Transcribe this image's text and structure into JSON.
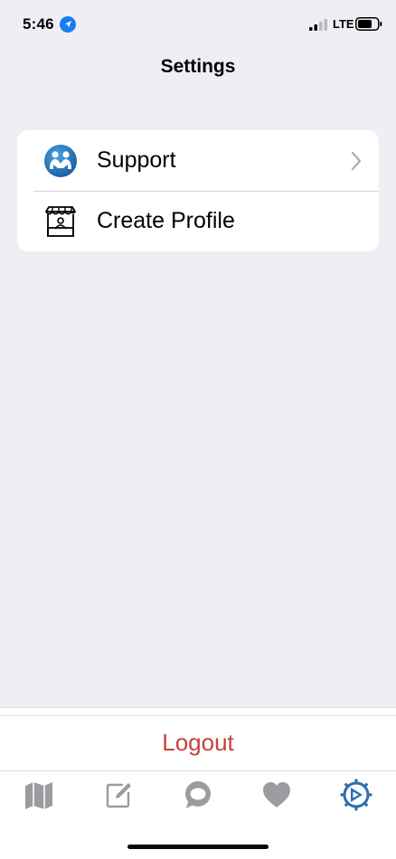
{
  "status_bar": {
    "time": "5:46",
    "network": "LTE"
  },
  "header": {
    "title": "Settings"
  },
  "settings": {
    "items": [
      {
        "label": "Support",
        "icon": "support-icon",
        "has_chevron": true
      },
      {
        "label": "Create Profile",
        "icon": "storefront-icon",
        "has_chevron": false
      }
    ]
  },
  "logout": {
    "label": "Logout",
    "color": "#c9403b"
  },
  "tab_bar": {
    "active_color": "#2f6fb1",
    "inactive_color": "#9b9ba0",
    "tabs": [
      {
        "icon": "map-icon",
        "active": false
      },
      {
        "icon": "compose-icon",
        "active": false
      },
      {
        "icon": "chat-icon",
        "active": false
      },
      {
        "icon": "heart-icon",
        "active": false
      },
      {
        "icon": "settings-gear-icon",
        "active": true
      }
    ]
  }
}
